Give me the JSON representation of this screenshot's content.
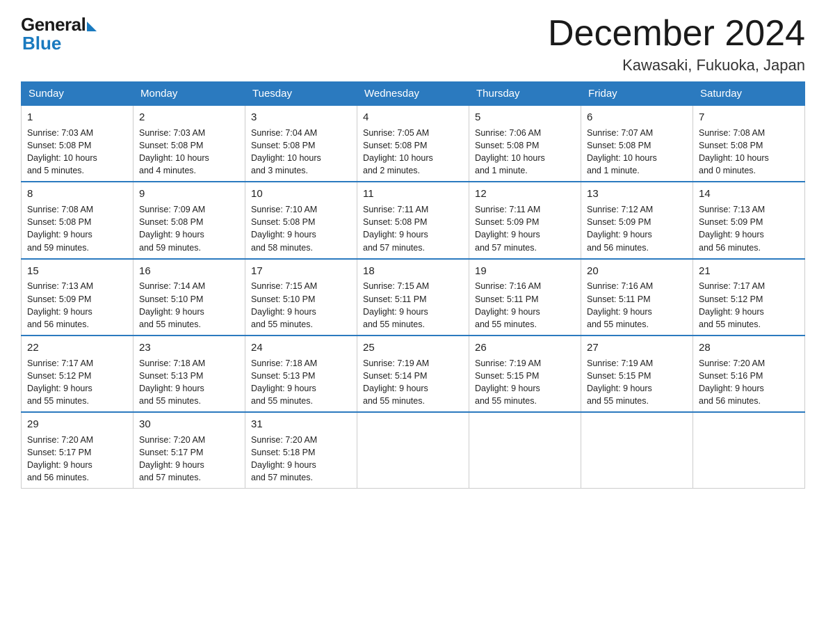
{
  "logo": {
    "general": "General",
    "blue": "Blue"
  },
  "title": "December 2024",
  "location": "Kawasaki, Fukuoka, Japan",
  "days_of_week": [
    "Sunday",
    "Monday",
    "Tuesday",
    "Wednesday",
    "Thursday",
    "Friday",
    "Saturday"
  ],
  "weeks": [
    [
      {
        "day": "1",
        "sunrise": "7:03 AM",
        "sunset": "5:08 PM",
        "daylight": "10 hours and 5 minutes."
      },
      {
        "day": "2",
        "sunrise": "7:03 AM",
        "sunset": "5:08 PM",
        "daylight": "10 hours and 4 minutes."
      },
      {
        "day": "3",
        "sunrise": "7:04 AM",
        "sunset": "5:08 PM",
        "daylight": "10 hours and 3 minutes."
      },
      {
        "day": "4",
        "sunrise": "7:05 AM",
        "sunset": "5:08 PM",
        "daylight": "10 hours and 2 minutes."
      },
      {
        "day": "5",
        "sunrise": "7:06 AM",
        "sunset": "5:08 PM",
        "daylight": "10 hours and 1 minute."
      },
      {
        "day": "6",
        "sunrise": "7:07 AM",
        "sunset": "5:08 PM",
        "daylight": "10 hours and 1 minute."
      },
      {
        "day": "7",
        "sunrise": "7:08 AM",
        "sunset": "5:08 PM",
        "daylight": "10 hours and 0 minutes."
      }
    ],
    [
      {
        "day": "8",
        "sunrise": "7:08 AM",
        "sunset": "5:08 PM",
        "daylight": "9 hours and 59 minutes."
      },
      {
        "day": "9",
        "sunrise": "7:09 AM",
        "sunset": "5:08 PM",
        "daylight": "9 hours and 59 minutes."
      },
      {
        "day": "10",
        "sunrise": "7:10 AM",
        "sunset": "5:08 PM",
        "daylight": "9 hours and 58 minutes."
      },
      {
        "day": "11",
        "sunrise": "7:11 AM",
        "sunset": "5:08 PM",
        "daylight": "9 hours and 57 minutes."
      },
      {
        "day": "12",
        "sunrise": "7:11 AM",
        "sunset": "5:09 PM",
        "daylight": "9 hours and 57 minutes."
      },
      {
        "day": "13",
        "sunrise": "7:12 AM",
        "sunset": "5:09 PM",
        "daylight": "9 hours and 56 minutes."
      },
      {
        "day": "14",
        "sunrise": "7:13 AM",
        "sunset": "5:09 PM",
        "daylight": "9 hours and 56 minutes."
      }
    ],
    [
      {
        "day": "15",
        "sunrise": "7:13 AM",
        "sunset": "5:09 PM",
        "daylight": "9 hours and 56 minutes."
      },
      {
        "day": "16",
        "sunrise": "7:14 AM",
        "sunset": "5:10 PM",
        "daylight": "9 hours and 55 minutes."
      },
      {
        "day": "17",
        "sunrise": "7:15 AM",
        "sunset": "5:10 PM",
        "daylight": "9 hours and 55 minutes."
      },
      {
        "day": "18",
        "sunrise": "7:15 AM",
        "sunset": "5:11 PM",
        "daylight": "9 hours and 55 minutes."
      },
      {
        "day": "19",
        "sunrise": "7:16 AM",
        "sunset": "5:11 PM",
        "daylight": "9 hours and 55 minutes."
      },
      {
        "day": "20",
        "sunrise": "7:16 AM",
        "sunset": "5:11 PM",
        "daylight": "9 hours and 55 minutes."
      },
      {
        "day": "21",
        "sunrise": "7:17 AM",
        "sunset": "5:12 PM",
        "daylight": "9 hours and 55 minutes."
      }
    ],
    [
      {
        "day": "22",
        "sunrise": "7:17 AM",
        "sunset": "5:12 PM",
        "daylight": "9 hours and 55 minutes."
      },
      {
        "day": "23",
        "sunrise": "7:18 AM",
        "sunset": "5:13 PM",
        "daylight": "9 hours and 55 minutes."
      },
      {
        "day": "24",
        "sunrise": "7:18 AM",
        "sunset": "5:13 PM",
        "daylight": "9 hours and 55 minutes."
      },
      {
        "day": "25",
        "sunrise": "7:19 AM",
        "sunset": "5:14 PM",
        "daylight": "9 hours and 55 minutes."
      },
      {
        "day": "26",
        "sunrise": "7:19 AM",
        "sunset": "5:15 PM",
        "daylight": "9 hours and 55 minutes."
      },
      {
        "day": "27",
        "sunrise": "7:19 AM",
        "sunset": "5:15 PM",
        "daylight": "9 hours and 55 minutes."
      },
      {
        "day": "28",
        "sunrise": "7:20 AM",
        "sunset": "5:16 PM",
        "daylight": "9 hours and 56 minutes."
      }
    ],
    [
      {
        "day": "29",
        "sunrise": "7:20 AM",
        "sunset": "5:17 PM",
        "daylight": "9 hours and 56 minutes."
      },
      {
        "day": "30",
        "sunrise": "7:20 AM",
        "sunset": "5:17 PM",
        "daylight": "9 hours and 57 minutes."
      },
      {
        "day": "31",
        "sunrise": "7:20 AM",
        "sunset": "5:18 PM",
        "daylight": "9 hours and 57 minutes."
      },
      null,
      null,
      null,
      null
    ]
  ],
  "labels": {
    "sunrise": "Sunrise:",
    "sunset": "Sunset:",
    "daylight": "Daylight:"
  }
}
